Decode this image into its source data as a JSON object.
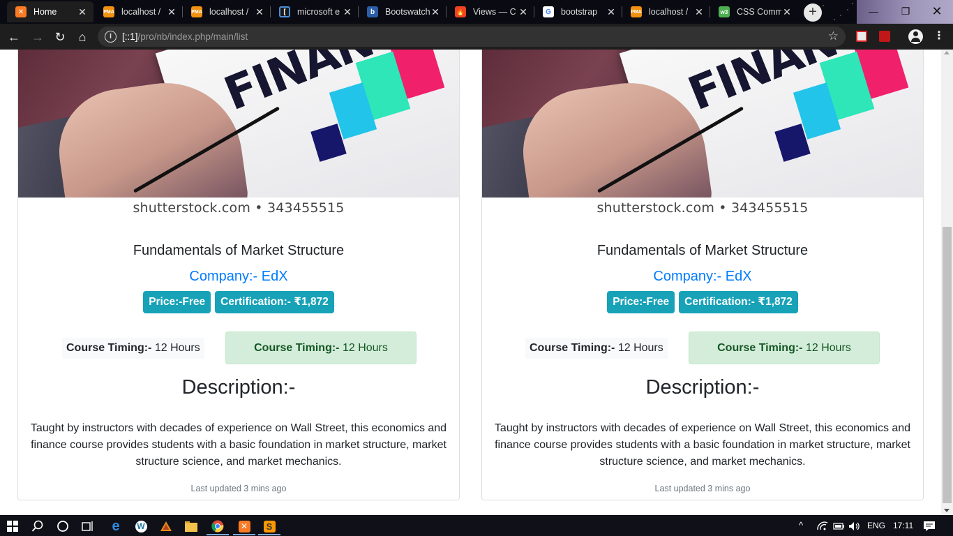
{
  "browser": {
    "tabs": [
      {
        "title": "Home",
        "favicon": "xampp-icon",
        "color": "#fb7a24",
        "active": true
      },
      {
        "title": "localhost /",
        "favicon": "phpmyadmin-icon",
        "color": "#f29111"
      },
      {
        "title": "localhost /",
        "favicon": "phpmyadmin-icon",
        "color": "#f29111"
      },
      {
        "title": "microsoft e",
        "favicon": "bracket-icon",
        "color": "#4a90d9"
      },
      {
        "title": "Bootswatch",
        "favicon": "bootswatch-icon",
        "color": "#2b5ea8"
      },
      {
        "title": "Views — C",
        "favicon": "codeigniter-icon",
        "color": "#ee4323"
      },
      {
        "title": "bootstrap",
        "favicon": "google-icon",
        "color": "#4285f4"
      },
      {
        "title": "localhost /",
        "favicon": "phpmyadmin-icon",
        "color": "#f29111"
      },
      {
        "title": "CSS Comm",
        "favicon": "w3schools-icon",
        "color": "#4caf50"
      }
    ],
    "new_tab": "+",
    "url_host": "[::1]",
    "url_path": "/pro/nb/index.php/main/list"
  },
  "cards": [
    {
      "watermark": "shutterstock.com • 343455515",
      "photo_word": "FINANCE",
      "title": "Fundamentals of Market Structure",
      "company": "Company:- EdX",
      "price": "Price:-Free",
      "certification": "Certification:-  ₹1,872",
      "timing_label": "Course Timing:-",
      "timing_value": " 12 Hours",
      "timing_alert_label": "Course Timing:-",
      "timing_alert_value": " 12 Hours",
      "description_heading": "Description:-",
      "description": "Taught by instructors with decades of experience on Wall Street, this economics and finance course provides students with a basic foundation in market structure, market structure science, and market mechanics.",
      "updated": "Last updated 3 mins ago"
    },
    {
      "watermark": "shutterstock.com • 343455515",
      "photo_word": "FINANCE",
      "title": "Fundamentals of Market Structure",
      "company": "Company:- EdX",
      "price": "Price:-Free",
      "certification": "Certification:-  ₹1,872",
      "timing_label": "Course Timing:-",
      "timing_value": " 12 Hours",
      "timing_alert_label": "Course Timing:-",
      "timing_alert_value": " 12 Hours",
      "description_heading": "Description:-",
      "description": "Taught by instructors with decades of experience on Wall Street, this economics and finance course provides students with a basic foundation in market structure, market structure science, and market mechanics.",
      "updated": "Last updated 3 mins ago"
    }
  ],
  "taskbar": {
    "language": "ENG",
    "time": "17:11"
  },
  "colors": {
    "primary": "#007bff",
    "info": "#17a2b8",
    "success_bg": "#d4edda",
    "success_text": "#155724"
  }
}
